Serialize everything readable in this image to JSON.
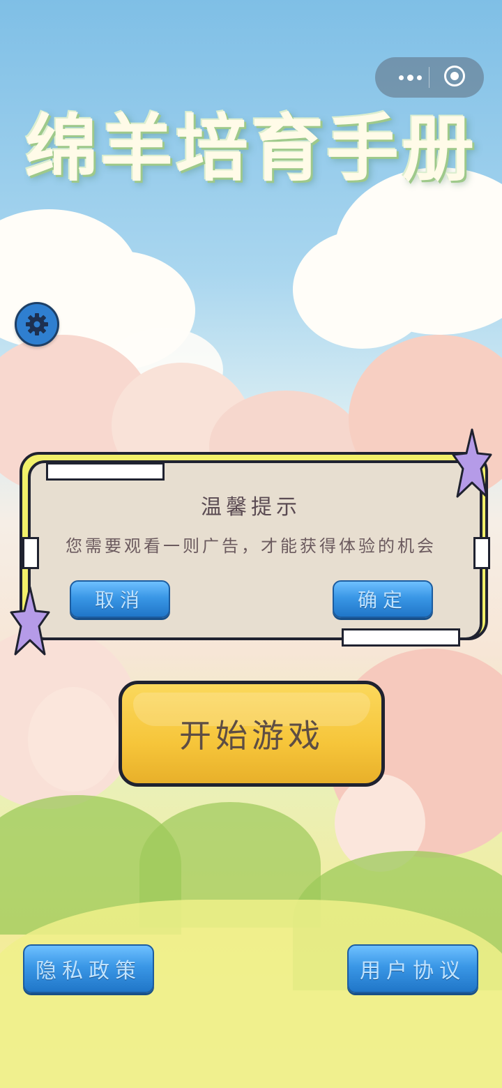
{
  "title": "绵羊培育手册",
  "capsule": {
    "more_icon": "more-dots-icon",
    "close_icon": "target-close-icon"
  },
  "settings": {
    "icon": "gear-icon"
  },
  "dialog": {
    "title": "温馨提示",
    "message": "您需要观看一则广告，才能获得体验的机会",
    "cancel_label": "取消",
    "confirm_label": "确定"
  },
  "start_label": "开始游戏",
  "privacy_label": "隐私政策",
  "agreement_label": "用户协议",
  "colors": {
    "accent_blue": "#2f86d6",
    "start_yellow": "#f6c53a",
    "star_purple": "#b59be8",
    "frame_yellow": "#f2f06a"
  }
}
